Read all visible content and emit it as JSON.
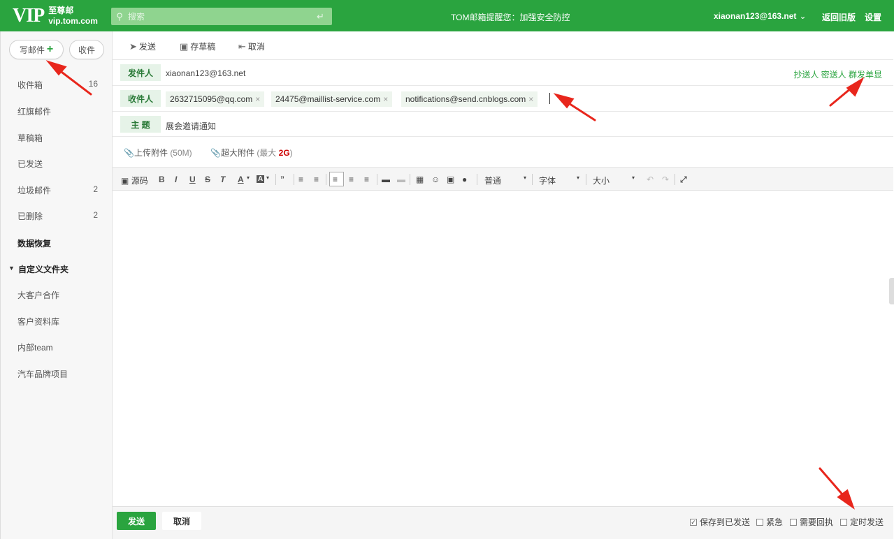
{
  "header": {
    "logo_vip": "VIP",
    "logo_line1": "至尊邮",
    "logo_line2": "vip.tom.com",
    "search_placeholder": "搜索",
    "notice": "TOM邮箱提醒您：加强安全防控",
    "account": "xiaonan123@163.net",
    "links": [
      "返回旧版",
      "设置"
    ]
  },
  "sidebar": {
    "compose_label": "写邮件",
    "receive_label": "收件",
    "folders": [
      {
        "label": "收件箱",
        "count": "16"
      },
      {
        "label": "红旗邮件",
        "count": ""
      },
      {
        "label": "草稿箱",
        "count": ""
      },
      {
        "label": "已发送",
        "count": ""
      },
      {
        "label": "垃圾邮件",
        "count": "2"
      },
      {
        "label": "已删除",
        "count": "2"
      },
      {
        "label": "数据恢复",
        "count": ""
      }
    ],
    "custom_title": "自定义文件夹",
    "custom_folders": [
      "大客户合作",
      "客户资料库",
      "内部team",
      "汽车品牌项目"
    ]
  },
  "toolbar": {
    "send": "发送",
    "save_draft": "存草稿",
    "cancel": "取消"
  },
  "compose": {
    "from_label": "发件人",
    "from_value": "xiaonan123@163.net",
    "extra_links": "抄送人 密送人 群发单显",
    "to_label": "收件人",
    "recipients": [
      "2632715095@qq.com",
      "24475@maillist-service.com",
      "notifications@send.cnblogs.com"
    ],
    "subject_label": "主  题",
    "subject_value": "展会邀请通知",
    "attach_label": "上传附件",
    "attach_limit": "(50M)",
    "big_attach_label": "超大附件",
    "big_attach_prefix": "(最大 ",
    "big_attach_size": "2G",
    "big_attach_suffix": ")"
  },
  "editor": {
    "source": "源码",
    "paragraph": "普通",
    "font": "字体",
    "size": "大小"
  },
  "footer": {
    "send": "发送",
    "cancel": "取消",
    "options": [
      {
        "label": "保存到已发送",
        "checked": true
      },
      {
        "label": "紧急",
        "checked": false
      },
      {
        "label": "需要回执",
        "checked": false
      },
      {
        "label": "定时发送",
        "checked": false
      }
    ]
  },
  "colors": {
    "brand": "#2aa43f",
    "annotation_arrow": "#e8261c"
  }
}
